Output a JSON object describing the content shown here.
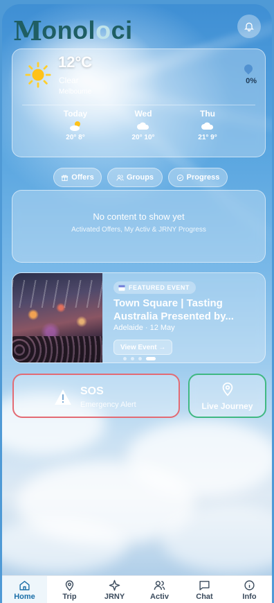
{
  "app": {
    "logo_m": "M",
    "logo_text_1": "onol",
    "logo_text_o": "o",
    "logo_text_2": "ci"
  },
  "weather": {
    "temp": "12°C",
    "condition": "Clear",
    "city": "Melbourne",
    "rain_chance": "0%",
    "forecast": [
      {
        "day": "Today",
        "temps": "20° 8°",
        "icon": "partly-sunny-icon"
      },
      {
        "day": "Wed",
        "temps": "20° 10°",
        "icon": "cloud-icon"
      },
      {
        "day": "Thu",
        "temps": "21° 9°",
        "icon": "cloud-icon"
      }
    ]
  },
  "chips": [
    {
      "label": "Offers",
      "icon": "gift-icon"
    },
    {
      "label": "Groups",
      "icon": "users-icon"
    },
    {
      "label": "Progress",
      "icon": "check-circle-icon"
    }
  ],
  "empty_state": {
    "title": "No content to show yet",
    "subtitle": "Activated Offers, My Activ & JRNY Progress"
  },
  "featured": {
    "badge": "FEATURED EVENT",
    "title": "Town Square | Tasting Australia Presented by...",
    "meta": "Adelaide · 12 May",
    "button": "View Event →",
    "page_count": 4,
    "active_page": 3
  },
  "sos": {
    "title": "SOS",
    "subtitle": "Emergency Alert",
    "border_color": "#e36a73"
  },
  "live_journey": {
    "label": "Live Journey",
    "border_color": "#3fb882"
  },
  "nav": {
    "active": "Home",
    "items": [
      {
        "label": "Home",
        "icon": "home-icon"
      },
      {
        "label": "Trip",
        "icon": "location-pin-icon"
      },
      {
        "label": "JRNY",
        "icon": "sparkle-icon"
      },
      {
        "label": "Activ",
        "icon": "people-icon"
      },
      {
        "label": "Chat",
        "icon": "chat-icon"
      },
      {
        "label": "Info",
        "icon": "info-icon"
      }
    ]
  },
  "colors": {
    "accent": "#1b6fa8",
    "logo": "#1f5e63",
    "sos": "#e36a73",
    "live": "#3fb882"
  }
}
